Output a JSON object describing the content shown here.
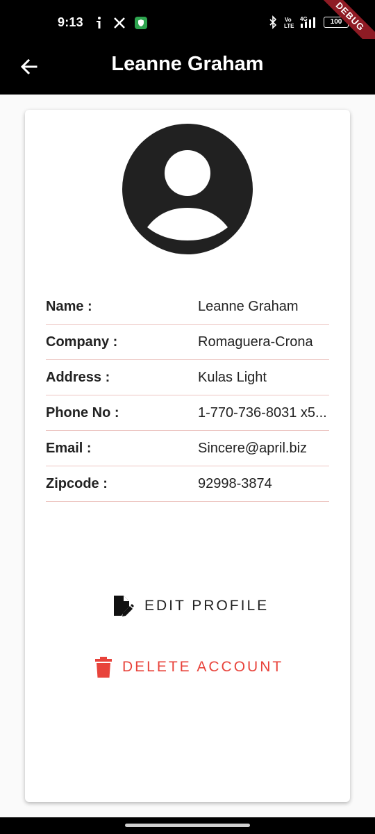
{
  "status_bar": {
    "time": "9:13",
    "battery": "100",
    "network": "4G",
    "volte": "Vo LTE",
    "debug_banner": "DEBUG"
  },
  "app_bar": {
    "title": "Leanne Graham",
    "back_icon": "arrow-back-icon"
  },
  "profile": {
    "avatar_icon": "account-circle-icon",
    "fields": [
      {
        "label": "Name :",
        "value": "Leanne Graham"
      },
      {
        "label": "Company :",
        "value": "Romaguera-Crona"
      },
      {
        "label": "Address :",
        "value": "Kulas Light"
      },
      {
        "label": "Phone No :",
        "value": "1-770-736-8031 x5..."
      },
      {
        "label": "Email :",
        "value": "Sincere@april.biz"
      },
      {
        "label": "Zipcode :",
        "value": "92998-3874"
      }
    ]
  },
  "actions": {
    "edit_label": "EDIT PROFILE",
    "edit_icon": "edit-document-icon",
    "delete_label": "DELETE ACCOUNT",
    "delete_icon": "trash-icon",
    "delete_color": "#e8433b"
  },
  "colors": {
    "app_bar": "#000000",
    "divider": "#ecc4c0",
    "avatar": "#212121"
  }
}
